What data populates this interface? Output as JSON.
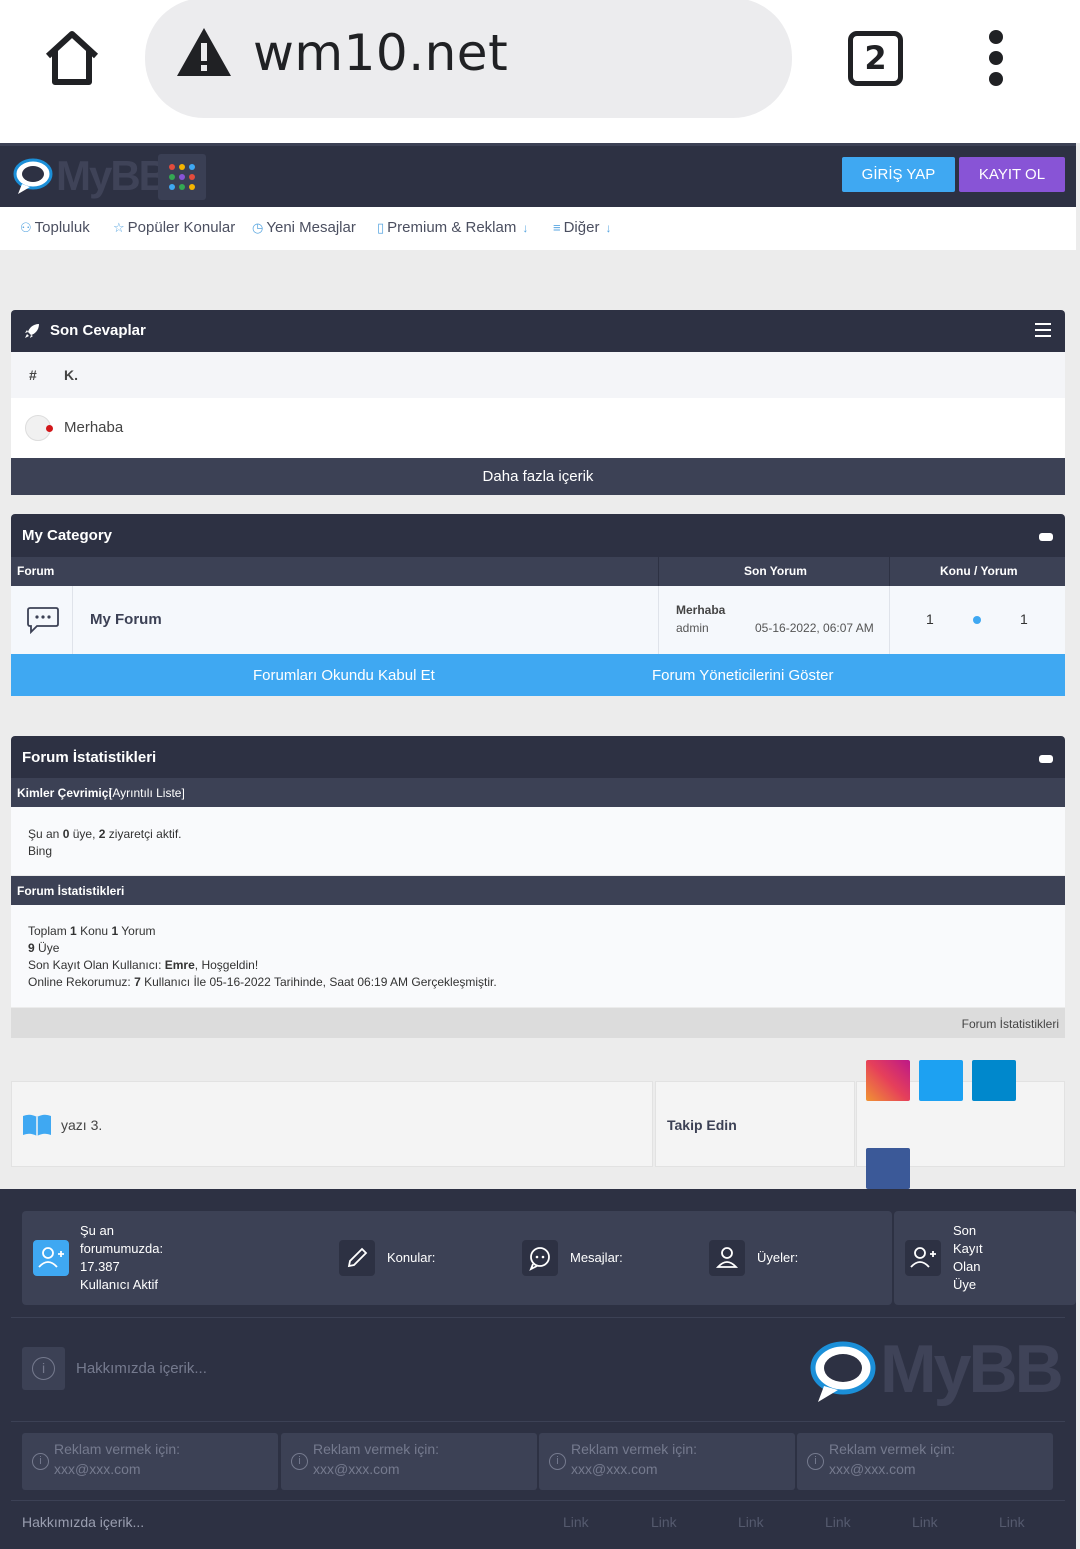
{
  "browser": {
    "url": "wm10.net",
    "tab_count": "2",
    "icons": [
      "home-icon",
      "warning-icon",
      "tabs-icon",
      "more-vert-icon"
    ]
  },
  "header": {
    "logo_text": "MyBB",
    "login_label": "GİRİŞ YAP",
    "register_label": "KAYIT OL",
    "colors": {
      "bg": "#2d3143",
      "login": "#3fa8f2",
      "register": "#8854d6"
    }
  },
  "nav": {
    "items": [
      {
        "label": "Topluluk",
        "icon": "users-icon"
      },
      {
        "label": "Popüler Konular",
        "icon": "star-icon"
      },
      {
        "label": "Yeni Mesajlar",
        "icon": "clock-icon"
      },
      {
        "label": "Premium & Reklam",
        "icon": "bookmark-icon"
      },
      {
        "label": "Diğer",
        "icon": "list-icon"
      }
    ]
  },
  "recent": {
    "title": "Son Cevaplar",
    "col_hash": "#",
    "col_k": "K.",
    "row_title": "Merhaba",
    "more_label": "Daha fazla içerik"
  },
  "category": {
    "title": "My Category",
    "col_forum": "Forum",
    "col_last": "Son Yorum",
    "col_counts": "Konu / Yorum",
    "forum_name": "My Forum",
    "last_title": "Merhaba",
    "last_user": "admin",
    "last_date": "05-16-2022, 06:07 AM",
    "topics": "1",
    "posts": "1",
    "mark_read_label": "Forumları Okundu Kabul Et",
    "show_mods_label": "Forum Yöneticilerini Göster",
    "accent": "#3fa8f2"
  },
  "stats": {
    "title": "Forum İstatistikleri",
    "online_head": "Kimler Çevrimiçi",
    "online_link": "[Ayrıntılı Liste]",
    "online_pre": "Şu an",
    "online_members": "0",
    "online_mid": "üye,",
    "online_guests": "2",
    "online_post": "ziyaretçi aktif.",
    "online_bot": "Bing",
    "stats_head": "Forum İstatistikleri",
    "total_pre": "Toplam",
    "total_topics": "1",
    "total_topics_label": "Konu",
    "total_posts": "1",
    "total_posts_label": "Yorum",
    "members_count": "9",
    "members_label": "Üye",
    "newest_pre": "Son Kayıt Olan Kullanıcı:",
    "newest_user": "Emre",
    "newest_post": ", Hoşgeldin!",
    "record_pre": "Online Rekorumuz:",
    "record_count": "7",
    "record_post": "Kullanıcı İle 05-16-2022 Tarihinde, Saat 06:19 AM Gerçekleşmiştir.",
    "footer_link": "Forum İstatistikleri"
  },
  "follow": {
    "text": "yazı 3.",
    "label": "Takip Edin",
    "socials": [
      {
        "name": "instagram",
        "color": "#e6405a"
      },
      {
        "name": "twitter",
        "color": "#1da1f2"
      },
      {
        "name": "telegram",
        "color": "#0088cc"
      },
      {
        "name": "facebook",
        "color": "#3b5998"
      }
    ]
  },
  "footer": {
    "online_line1": "Şu an",
    "online_line2": "forumumuzda:",
    "online_line3": "17.387",
    "online_line4": "Kullanıcı Aktif",
    "topics_label": "Konular:",
    "posts_label": "Mesajlar:",
    "members_label": "Üyeler:",
    "last_line1": "Son",
    "last_line2": "Kayıt",
    "last_line3": "Olan",
    "last_line4": "Üye",
    "about": "Hakkımızda içerik...",
    "logo_text": "MyBB",
    "ads": [
      {
        "line1": "Reklam vermek için:",
        "line2": "xxx@xxx.com"
      },
      {
        "line1": "Reklam vermek için:",
        "line2": "xxx@xxx.com"
      },
      {
        "line1": "Reklam vermek için:",
        "line2": "xxx@xxx.com"
      },
      {
        "line1": "Reklam vermek için:",
        "line2": "xxx@xxx.com"
      }
    ],
    "bottom_about": "Hakkımızda içerik...",
    "links": [
      "Link",
      "Link",
      "Link",
      "Link",
      "Link",
      "Link"
    ]
  }
}
